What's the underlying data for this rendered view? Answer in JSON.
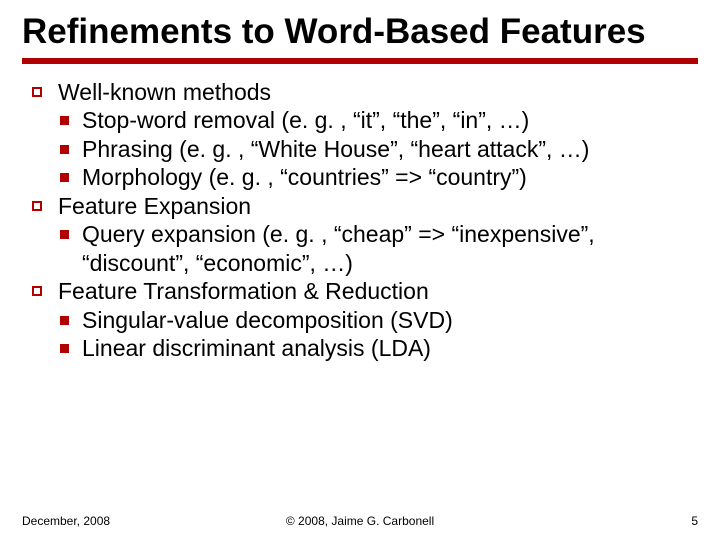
{
  "title": "Refinements to Word-Based Features",
  "bullets": [
    {
      "text": "Well-known methods",
      "children": [
        {
          "text": "Stop-word removal (e. g. , “it”, “the”, “in”, …)"
        },
        {
          "text": "Phrasing (e. g. , “White House”, “heart attack”, …)"
        },
        {
          "text": "Morphology (e. g. , “countries” => “country”)"
        }
      ]
    },
    {
      "text": "Feature Expansion",
      "children": [
        {
          "text": "Query expansion (e. g. , “cheap” => “inexpensive”, “discount”, “economic”, …)"
        }
      ]
    },
    {
      "text": "Feature Transformation & Reduction",
      "children": [
        {
          "text": "Singular-value decomposition (SVD)"
        },
        {
          "text": "Linear discriminant analysis (LDA)"
        }
      ]
    }
  ],
  "footer": {
    "left": "December, 2008",
    "center": "© 2008, Jaime G. Carbonell",
    "right": "5"
  }
}
